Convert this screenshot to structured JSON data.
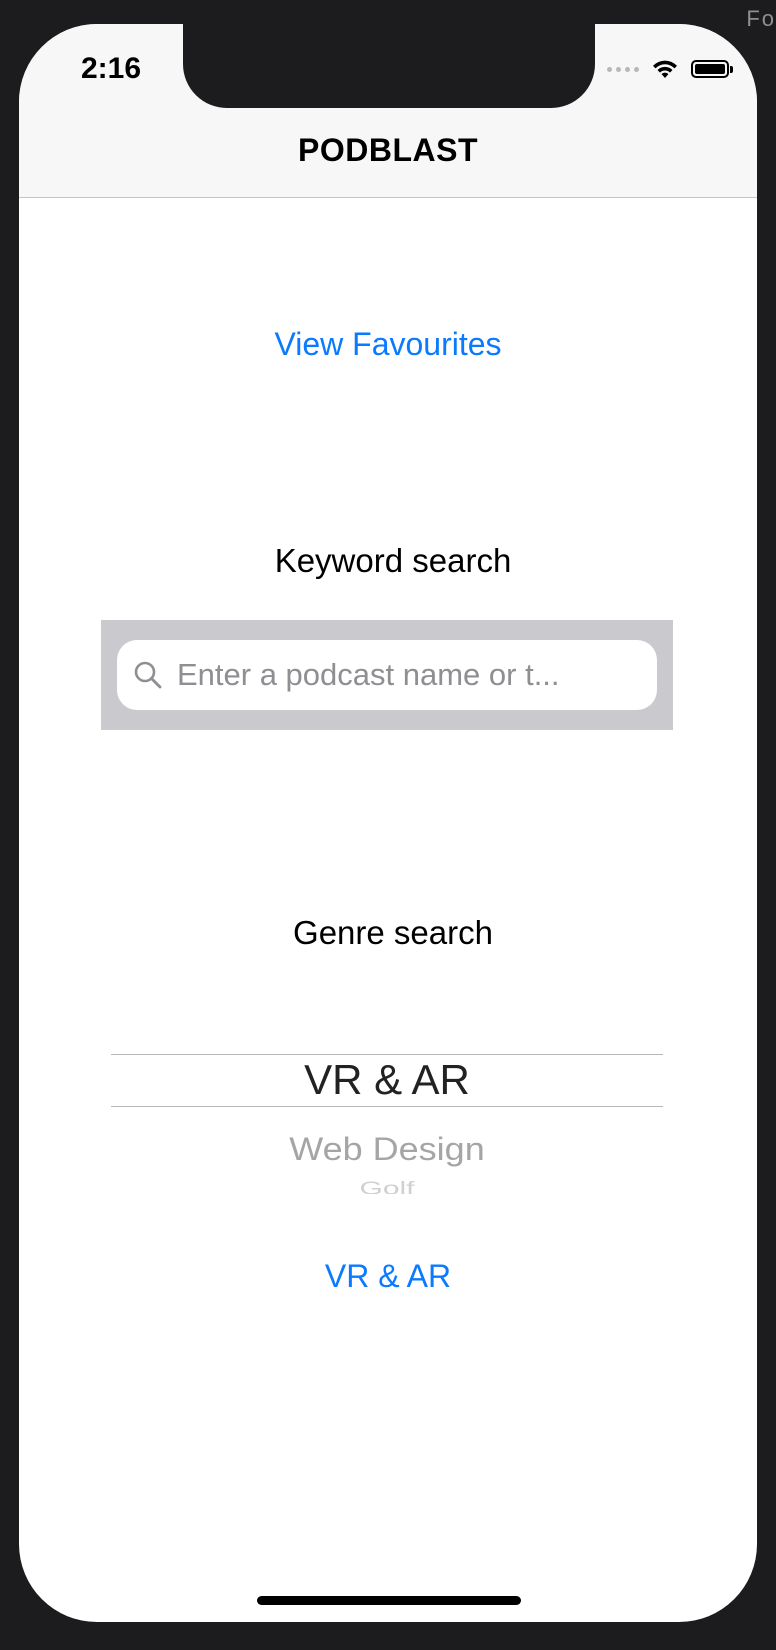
{
  "corner_text": "Fo",
  "status_bar": {
    "time": "2:16",
    "icons": [
      "cellular-dots-icon",
      "wifi-icon",
      "battery-icon"
    ]
  },
  "nav": {
    "title": "PODBLAST"
  },
  "favourites": {
    "label": "View Favourites"
  },
  "keyword_search": {
    "label": "Keyword search",
    "placeholder": "Enter a podcast name or t...",
    "value": ""
  },
  "genre_search": {
    "label": "Genre search",
    "picker": {
      "selected": "VR & AR",
      "visible_options": [
        "VR & AR",
        "Web Design",
        "Golf"
      ]
    },
    "selected_label": "VR & AR"
  },
  "colors": {
    "accent": "#0a7aff",
    "search_bar_bg": "#c9c9ce",
    "navbar_bg": "#f7f7f7"
  }
}
